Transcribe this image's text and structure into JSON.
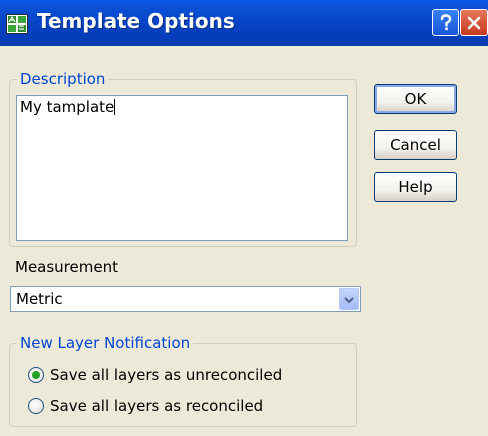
{
  "window": {
    "title": "Template Options"
  },
  "title_bar": {
    "help_icon": "question-icon",
    "close_icon": "close-icon"
  },
  "description": {
    "group_label": "Description",
    "value": "My tamplate"
  },
  "buttons": {
    "ok": "OK",
    "cancel": "Cancel",
    "help": "Help"
  },
  "measurement": {
    "label": "Measurement",
    "selected": "Metric"
  },
  "new_layer_notification": {
    "group_label": "New Layer Notification",
    "options": [
      {
        "label": "Save all layers as unreconciled",
        "checked": true
      },
      {
        "label": "Save all layers as reconciled",
        "checked": false
      }
    ]
  },
  "colors": {
    "title_bar": "#0A52D9",
    "group_label": "#0046D5",
    "dialog_bg": "#ECE9D8"
  }
}
